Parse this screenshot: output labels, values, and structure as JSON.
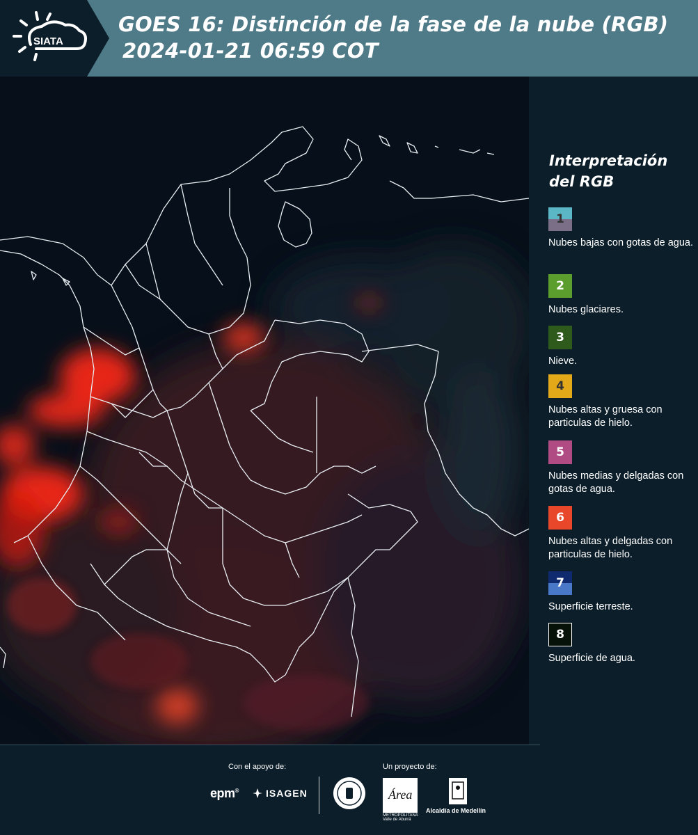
{
  "header": {
    "logo_text": "SIATA",
    "title_line1": "GOES 16: Distinción de la fase de la nube (RGB)",
    "title_line2": "2024-01-21 06:59 COT"
  },
  "legend": {
    "title_line1": "Interpretación",
    "title_line2": "del RGB",
    "items": [
      {
        "number": "1",
        "label": "Nubes bajas con gotas de agua.",
        "color_top": "#5bb6c6",
        "color_bottom": "#7a6f86",
        "text_color": "#333333"
      },
      {
        "number": "2",
        "label": "Nubes glaciares.",
        "color": "#5c9e2e",
        "text_color": "#ffffff"
      },
      {
        "number": "3",
        "label": "Nieve.",
        "color": "#2e5a1c",
        "text_color": "#ffffff"
      },
      {
        "number": "4",
        "label": "Nubes altas y gruesa con particulas de hielo.",
        "color": "#e3a918",
        "text_color": "#333333"
      },
      {
        "number": "5",
        "label": "Nubes medias y delgadas con gotas de agua.",
        "color": "#b04c83",
        "text_color": "#ffffff"
      },
      {
        "number": "6",
        "label": "Nubes altas y delgadas con particulas de hielo.",
        "color": "#e8472a",
        "text_color": "#ffffff"
      },
      {
        "number": "7",
        "label": "Superficie terreste.",
        "color_top": "#0f2a6e",
        "color_bottom": "#4a78c8",
        "text_color": "#ffffff"
      },
      {
        "number": "8",
        "label": "Superficie de agua.",
        "color": "#061208",
        "border": "#ffffff",
        "text_color": "#ffffff"
      }
    ]
  },
  "footer": {
    "support_label": "Con el apoyo de:",
    "project_label": "Un proyecto de:",
    "epm": "epm",
    "isagen": "ISAGEN",
    "area_text": "METROPOLITANA Valle de Aburrá",
    "area_logo": "Área",
    "alcaldia": "Alcaldía de Medellín"
  },
  "colors": {
    "header_band": "#4f7a88",
    "background": "#0c1e2a",
    "map_background": "#07101a",
    "cloud_red": "#ff2a1a"
  }
}
